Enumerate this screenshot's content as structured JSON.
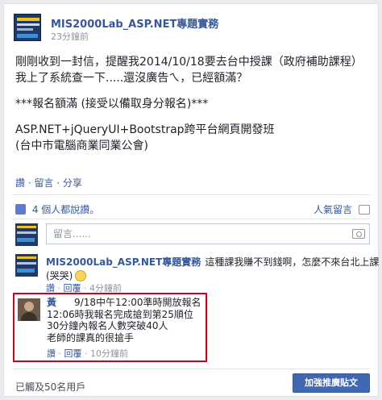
{
  "post": {
    "page_name": "MIS2000Lab_ASP.NET專題實務",
    "time": "23分鐘前",
    "lines": [
      "剛剛收到一封信，提醒我2014/10/18要去台中授課（政府補助課程）",
      "我上了系統查一下.....還沒廣告ㄟ，已經額滿？",
      "",
      "***報名額滿 (接受以備取身分報名)***",
      "",
      "ASP.NET+jQueryUI+Bootstrap跨平台網頁開發班",
      "(台中市電腦商業同業公會)"
    ],
    "actions": "讚 · 留言 · 分享"
  },
  "likes": {
    "text": "4 個人都說讚。",
    "people_reached": "人氣留言"
  },
  "comment_input": {
    "placeholder": "留言......"
  },
  "comments": [
    {
      "author": "MIS2000Lab_ASP.NET專題實務",
      "text_line1": "這種課我賺不到錢啊，怎麼不來台北上課",
      "text_line2": "(哭哭)",
      "meta_like": "讚",
      "meta_reply": "回覆",
      "meta_time": "4分鐘前"
    },
    {
      "author": "黃",
      "lines": [
        "9/18中午12:00準時開放報名",
        "12:06時我報名完成搶到第25順位",
        "30分鐘內報名人數突破40人",
        "老師的課真的很搶手"
      ],
      "meta_like": "讚",
      "meta_reply": "回覆",
      "meta_time": "10分鐘前"
    }
  ],
  "footer": {
    "reach": "已觸及50名用戶",
    "boost_label": "加強推廣貼文"
  },
  "colors": {
    "link": "#365899",
    "highlight_border": "#d0021b",
    "button": "#4267b2"
  }
}
